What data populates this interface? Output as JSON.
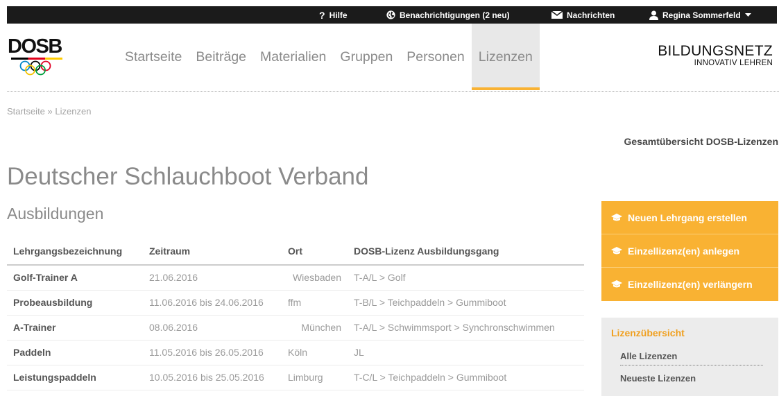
{
  "topbar": {
    "help": "Hilfe",
    "notifications": "Benachrichtigungen (2 neu)",
    "messages": "Nachrichten",
    "user": "Regina Sommerfeld"
  },
  "logo": {
    "text": "DOSB"
  },
  "nav": {
    "items": [
      "Startseite",
      "Beiträge",
      "Materialien",
      "Gruppen",
      "Personen",
      "Lizenzen"
    ],
    "active": "Lizenzen"
  },
  "brand": {
    "title": "BILDUNGSNETZ",
    "subtitle": "INNOVATIV LEHREN"
  },
  "breadcrumb": {
    "home": "Startseite",
    "separator": "»",
    "current": "Lizenzen"
  },
  "overview_link": "Gesamtübersicht DOSB-Lizenzen",
  "page_title": "Deutscher Schlauchboot Verband",
  "section_title": "Ausbildungen",
  "table": {
    "headers": [
      "Lehrgangsbezeichnung",
      "Zeitraum",
      "Ort",
      "DOSB-Lizenz Ausbildungsgang"
    ],
    "rows": [
      [
        "Golf-Trainer A",
        "21.06.2016",
        "Wiesbaden",
        "T-A/L > Golf"
      ],
      [
        "Probeausbildung",
        "11.06.2016 bis 24.06.2016",
        "ffm",
        "T-B/L > Teichpaddeln > Gummiboot"
      ],
      [
        "A-Trainer",
        "08.06.2016",
        "München",
        "T-A/L > Schwimmsport > Synchronschwimmen"
      ],
      [
        "Paddeln",
        "11.05.2016 bis 26.05.2016",
        "Köln",
        "JL"
      ],
      [
        "Leistungspaddeln",
        "10.05.2016 bis 25.05.2016",
        "Limburg",
        "T-C/L > Teichpaddeln > Gummiboot"
      ]
    ]
  },
  "sidebar": {
    "buttons": [
      "Neuen Lehrgang erstellen",
      "Einzellizenz(en) anlegen",
      "Einzellizenz(en) verlängern"
    ],
    "overview_title": "Lizenzübersicht",
    "overview_items": [
      "Alle Lizenzen",
      "Neueste Lizenzen"
    ]
  },
  "colors": {
    "accent": "#f9b233",
    "topbar": "#1b1b1b",
    "text": "#555555",
    "muted": "#8a8a8a"
  },
  "icons": {
    "help": "question-icon",
    "notifications": "globe-icon",
    "messages": "envelope-icon",
    "user": "user-icon",
    "buttons": "graduation-cap-icon"
  }
}
